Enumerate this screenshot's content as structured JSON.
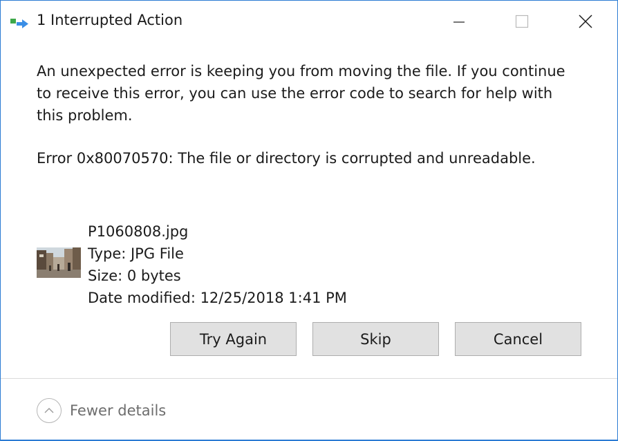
{
  "window": {
    "title": "1 Interrupted Action",
    "accent_color": "#2b7bd3"
  },
  "window_controls": {
    "minimize_icon": "minimize-icon",
    "maximize_icon": "maximize-icon",
    "close_icon": "close-icon"
  },
  "message": {
    "line1": "An unexpected error is keeping you from moving the file. If you continue",
    "line2": "to receive this error, you can use the error code to search for help with",
    "line3": "this problem.",
    "error": "Error 0x80070570: The file or directory is corrupted and unreadable."
  },
  "file": {
    "name": "P1060808.jpg",
    "type": "Type: JPG File",
    "size": "Size: 0 bytes",
    "date_modified": "Date modified: 12/25/2018 1:41 PM",
    "thumbnail_icon": "photo-thumbnail"
  },
  "buttons": {
    "try_again": "Try Again",
    "skip": "Skip",
    "cancel": "Cancel"
  },
  "footer": {
    "details_label": "Fewer details",
    "details_icon": "chevron-up-icon"
  }
}
